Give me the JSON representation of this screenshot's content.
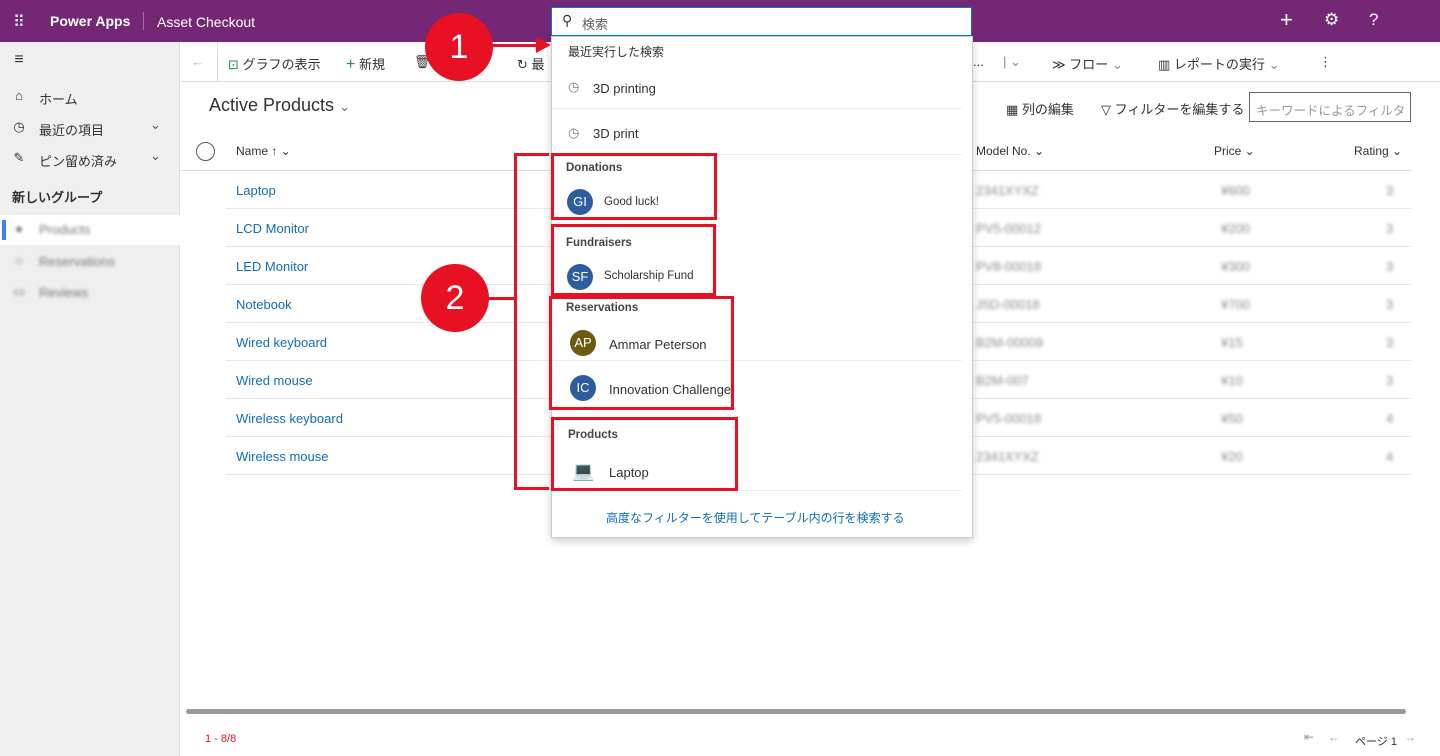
{
  "topbar": {
    "app_name": "Power Apps",
    "environment": "Asset Checkout",
    "add_icon": "+",
    "settings_icon": "gear",
    "help_icon": "?"
  },
  "search": {
    "placeholder": "検索"
  },
  "sidebar": {
    "home": "ホーム",
    "recent": "最近の項目",
    "pinned": "ピン留め済み",
    "group": "新しいグループ",
    "items": [
      {
        "label": "Products",
        "selected": true
      },
      {
        "label": "Reservations"
      },
      {
        "label": "Reviews"
      }
    ]
  },
  "commandbar": {
    "show_chart": "グラフの表示",
    "new": "新規",
    "refresh_partial": "最",
    "more_partial": "...",
    "flow": "フロー",
    "run_report": "レポートの実行"
  },
  "view": {
    "title": "Active Products",
    "edit_columns": "列の編集",
    "edit_filters": "フィルターを編集する",
    "keyword_filter_placeholder": "キーワードによるフィルタ"
  },
  "grid": {
    "columns": [
      "Name",
      "Model No.",
      "Price",
      "Rating"
    ],
    "rows": [
      {
        "name": "Laptop",
        "model": "2341XYXZ",
        "price": "¥600",
        "rating": "3"
      },
      {
        "name": "LCD Monitor",
        "model": "PV5-00012",
        "price": "¥200",
        "rating": "3"
      },
      {
        "name": "LED Monitor",
        "model": "PV8-00018",
        "price": "¥300",
        "rating": "3"
      },
      {
        "name": "Notebook",
        "model": "J5D-00018",
        "price": "¥700",
        "rating": "3"
      },
      {
        "name": "Wired keyboard",
        "model": "B2M-00009",
        "price": "¥15",
        "rating": "3"
      },
      {
        "name": "Wired mouse",
        "model": "B2M-007",
        "price": "¥10",
        "rating": "3"
      },
      {
        "name": "Wireless keyboard",
        "model": "PV5-00018",
        "price": "¥50",
        "rating": "4"
      },
      {
        "name": "Wireless mouse",
        "model": "2341XYXZ",
        "price": "¥20",
        "rating": "4"
      }
    ]
  },
  "footer": {
    "count": "1 - 8/8",
    "page": "ページ 1"
  },
  "dropdown": {
    "recent_header": "最近実行した検索",
    "recent": [
      "3D printing",
      "3D print"
    ],
    "groups": [
      {
        "category": "Donations",
        "items": [
          {
            "initials": "GI",
            "label": "Good luck!",
            "color": "#2e5d9f"
          }
        ]
      },
      {
        "category": "Fundraisers",
        "items": [
          {
            "initials": "SF",
            "label": "Scholarship Fund",
            "color": "#2e5d9f"
          }
        ]
      },
      {
        "category": "Reservations",
        "items": [
          {
            "initials": "AP",
            "label": "Ammar Peterson",
            "color": "#6b5a10"
          },
          {
            "initials": "IC",
            "label": "Innovation Challenge",
            "color": "#2e5d9f"
          }
        ]
      },
      {
        "category": "Products",
        "items": [
          {
            "initials": "",
            "label": "Laptop"
          }
        ]
      }
    ],
    "advanced_link": "高度なフィルターを使用してテーブル内の行を検索する"
  },
  "annotations": {
    "one": "1",
    "two": "2",
    "color": "#e81123"
  }
}
